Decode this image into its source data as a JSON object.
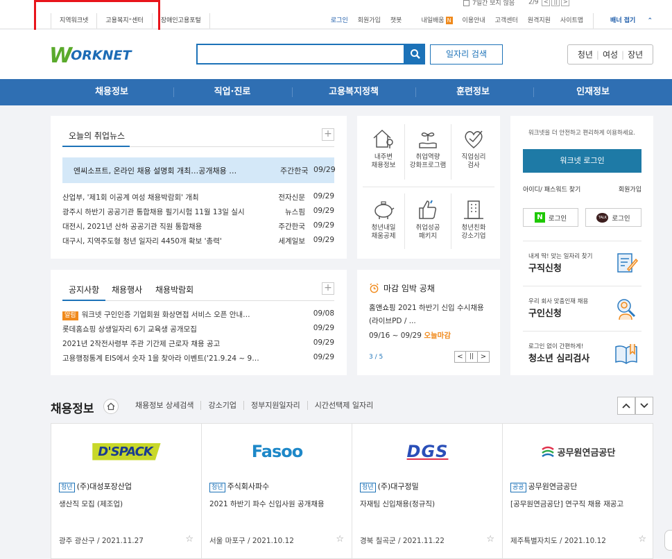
{
  "topstrip": {
    "banner_hide_label": "7일간 보지 않음",
    "pager_text": "2/9",
    "pager_controls": [
      "<",
      "||",
      ">"
    ]
  },
  "utilbar": {
    "left_links": [
      "지역워크넷",
      "고용복지⁺센터",
      "장애인고용포털"
    ],
    "right_links": [
      "로그인",
      "회원가입",
      "챗봇",
      "내일배움",
      "이용안내",
      "고객센터",
      "원격지원",
      "사이트맵"
    ],
    "badge": "N",
    "banner_toggle": "배너 접기"
  },
  "header": {
    "logo_w": "W",
    "logo_text": "ORKNET",
    "search_placeholder": "",
    "job_search_button": "일자리 검색",
    "age_buttons": [
      "청년",
      "여성",
      "장년"
    ]
  },
  "gnb": {
    "items": [
      "채용정보",
      "직업·진로",
      "고용복지정책",
      "훈련정보",
      "인재정보"
    ]
  },
  "news": {
    "tab": "오늘의 취업뉴스",
    "plus": "+",
    "headline": {
      "title": "엔씨소프트, 온라인 채용 설명회 개최…공개채용 …",
      "source": "주간한국",
      "date": "09/29"
    },
    "rows": [
      {
        "title": "산업부, '제1회 이공계 여성 채용박람회' 개최",
        "source": "전자신문",
        "date": "09/29"
      },
      {
        "title": "광주시 하반기 공공기관 통합채용 필기시험 11월 13일 실시",
        "source": "뉴스핌",
        "date": "09/29"
      },
      {
        "title": "대전시, 2021년 산하 공공기관 직원 통합채용",
        "source": "주간한국",
        "date": "09/29"
      },
      {
        "title": "대구시, 지역주도형 청년 일자리 4450개 확보 '총력'",
        "source": "세계일보",
        "date": "09/29"
      }
    ]
  },
  "quicklinks": {
    "items": [
      {
        "line1": "내주변",
        "line2": "채용정보"
      },
      {
        "line1": "취업역량",
        "line2": "강화프로그램"
      },
      {
        "line1": "직업심리",
        "line2": "검사"
      },
      {
        "line1": "청년내일",
        "line2": "채움공제"
      },
      {
        "line1": "취업성공",
        "line2": "패키지"
      },
      {
        "line1": "청년친화",
        "line2": "강소기업"
      }
    ]
  },
  "notice": {
    "tabs": [
      "공지사항",
      "채용행사",
      "채용박람회"
    ],
    "plus": "+",
    "tag": "알림",
    "rows": [
      {
        "title": "워크넷 구인인증 기업회원 화상면접 서비스 오픈 안내…",
        "date": "09/08"
      },
      {
        "title": "롯데홈쇼핑 상생일자리 6기 교육생 공개모집",
        "date": "09/29"
      },
      {
        "title": "2021년 2작전사령부 주관 기간제 근로자 채용 공고",
        "date": "09/29"
      },
      {
        "title": "고용행정통계 EIS에서 숫자 1을 찾아라 이벤트('21.9.24 ~ 9…",
        "date": "09/29"
      }
    ]
  },
  "deadline": {
    "title": "마감 임박 공채",
    "company": "홈앤쇼핑",
    "desc": "2021 하반기 신입 수시채용 (라이브PD / ...",
    "period": "09/16 ~ 09/29",
    "today": "오늘마감",
    "page": "3 / 5",
    "controls": [
      "<",
      "||",
      ">"
    ]
  },
  "login": {
    "intro": "워크넷을 더 안전하고 편리하게 이용하세요.",
    "button": "워크넷 로그인",
    "find": "아이디/ 패스워드 찾기",
    "join": "회원가입",
    "naver_label": "로그인",
    "naver_mark": "N",
    "kakao_label": "로그인",
    "kakao_mark": "TALK",
    "promos": [
      {
        "sub": "내게 딱! 맞는 일자리 찾기",
        "title": "구직신청"
      },
      {
        "sub": "우리 회사 맞춤인재 채용",
        "title": "구인신청"
      },
      {
        "sub": "로그인 없이 간편하게!",
        "title": "청소년 심리검사"
      }
    ]
  },
  "jobsection": {
    "title": "채용정보",
    "links": [
      "채용정보 상세검색",
      "강소기업",
      "정부지원일자리",
      "시간선택제 일자리"
    ],
    "jobs": [
      {
        "logo": "D'SPACK",
        "tag": "청년",
        "company": "(주)대성포장산업",
        "title": "생산직 모집 (제조업)",
        "loc": "광주 광산구 / 2021.11.27"
      },
      {
        "logo": "Fasoo",
        "tag": "청년",
        "company": "주식회사파수",
        "title": "2021 하반기 파수 신입사원 공개채용",
        "loc": "서울 마포구 / 2021.10.12"
      },
      {
        "logo": "DGS",
        "tag": "청년",
        "company": "(주)대구정밀",
        "title": "자재팀 신입채용(정규직)",
        "loc": "경북 칠곡군 / 2021.11.22"
      },
      {
        "logo": "공무원연금공단",
        "tag": "공공",
        "company": "공무원연금공단",
        "title": "[공무원연금공단] 연구직 채용 재공고",
        "loc": "제주특별자치도 / 2021.10.12"
      }
    ],
    "star": "☆"
  }
}
